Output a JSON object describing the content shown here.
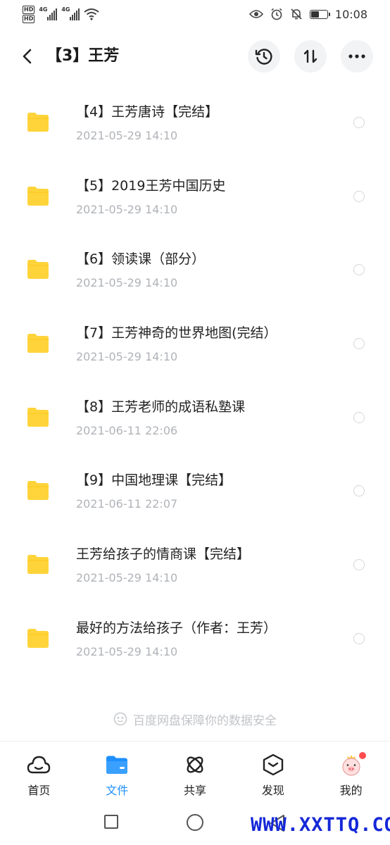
{
  "status_bar": {
    "hd1": "HD",
    "hd2": "HD",
    "net1": "4G",
    "net2": "4G",
    "time": "10:08",
    "battery_level": 0.45
  },
  "header": {
    "title": "【3】王芳"
  },
  "files": [
    {
      "name": "【4】王芳唐诗【完结】",
      "date": "2021-05-29  14:10"
    },
    {
      "name": "【5】2019王芳中国历史",
      "date": "2021-05-29  14:10"
    },
    {
      "name": "【6】领读课（部分）",
      "date": "2021-05-29  14:10"
    },
    {
      "name": "【7】王芳神奇的世界地图(完结）",
      "date": "2021-05-29  14:10"
    },
    {
      "name": "【8】王芳老师的成语私塾课",
      "date": "2021-06-11  22:06"
    },
    {
      "name": "【9】中国地理课【完结】",
      "date": "2021-06-11  22:07"
    },
    {
      "name": "王芳给孩子的情商课【完结】",
      "date": "2021-05-29  14:10"
    },
    {
      "name": "最好的方法给孩子（作者：王芳）",
      "date": "2021-05-29  14:10"
    }
  ],
  "security_note": "百度网盘保障你的数据安全",
  "tabs": [
    {
      "label": "首页",
      "icon": "cloud-icon"
    },
    {
      "label": "文件",
      "icon": "folder-icon"
    },
    {
      "label": "共享",
      "icon": "atom-icon"
    },
    {
      "label": "发现",
      "icon": "cube-icon"
    },
    {
      "label": "我的",
      "icon": "avatar-icon"
    }
  ],
  "watermark": "WWW.XXTTQ.COM",
  "colors": {
    "accent": "#1e8fff",
    "folder": "#ffd43b",
    "badge": "#ff4d4f",
    "watermark": "#1428d8"
  }
}
